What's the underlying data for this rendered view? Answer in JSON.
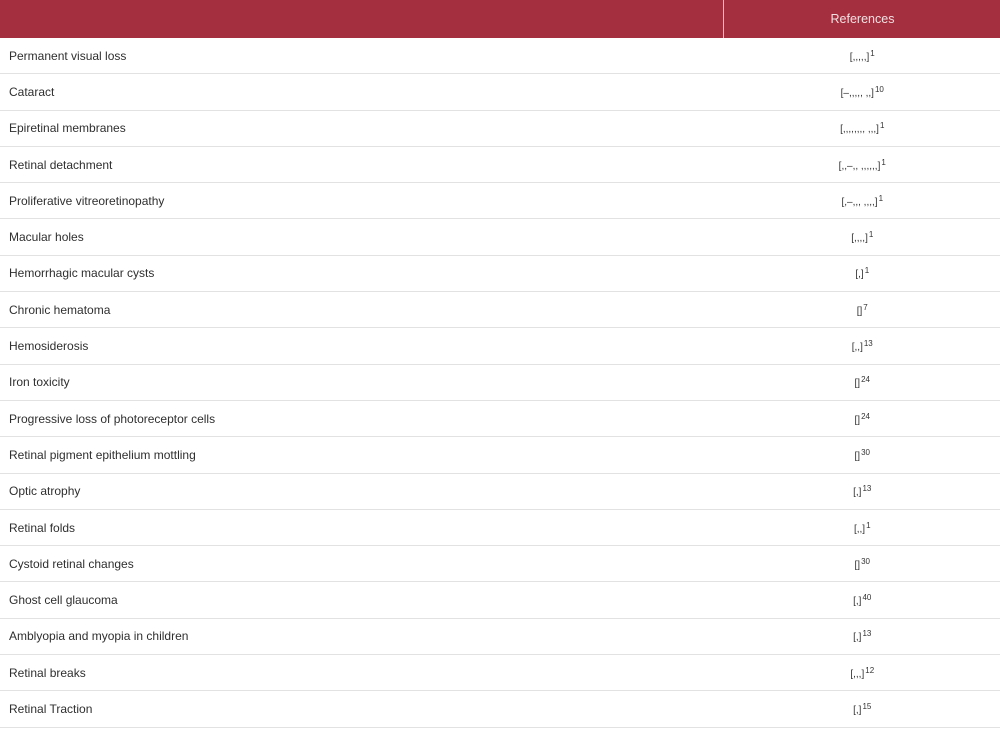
{
  "table": {
    "headers": [
      "",
      "References"
    ],
    "rows": [
      {
        "condition": "Permanent visual loss",
        "ref": "[,,,,,]",
        "sup": "1"
      },
      {
        "condition": "Cataract",
        "ref": "[–,,,,, ,,]",
        "sup": "10"
      },
      {
        "condition": "Epiretinal membranes",
        "ref": "[,,,,,,,, ,,,]",
        "sup": "1"
      },
      {
        "condition": "Retinal detachment",
        "ref": "[,,–,, ,,,,,,]",
        "sup": "1"
      },
      {
        "condition": "Proliferative vitreoretinopathy",
        "ref": "[,–,,, ,,,,]",
        "sup": "1"
      },
      {
        "condition": "Macular holes",
        "ref": "[,,,,]",
        "sup": "1"
      },
      {
        "condition": "Hemorrhagic macular cysts",
        "ref": "[,]",
        "sup": "1"
      },
      {
        "condition": "Chronic hematoma",
        "ref": "[]",
        "sup": "7"
      },
      {
        "condition": "Hemosiderosis",
        "ref": "[,,]",
        "sup": "13"
      },
      {
        "condition": "Iron toxicity",
        "ref": "[]",
        "sup": "24"
      },
      {
        "condition": "Progressive loss of photoreceptor cells",
        "ref": "[]",
        "sup": "24"
      },
      {
        "condition": "Retinal pigment epithelium mottling",
        "ref": "[]",
        "sup": "30"
      },
      {
        "condition": "Optic atrophy",
        "ref": "[,]",
        "sup": "13"
      },
      {
        "condition": "Retinal folds",
        "ref": "[,,]",
        "sup": "1"
      },
      {
        "condition": "Cystoid retinal changes",
        "ref": "[]",
        "sup": "30"
      },
      {
        "condition": "Ghost cell glaucoma",
        "ref": "[,]",
        "sup": "40"
      },
      {
        "condition": "Amblyopia and myopia in children",
        "ref": "[,]",
        "sup": "13"
      },
      {
        "condition": "Retinal breaks",
        "ref": "[,,,]",
        "sup": "12"
      },
      {
        "condition": "Retinal Traction",
        "ref": "[,]",
        "sup": "15"
      }
    ]
  }
}
